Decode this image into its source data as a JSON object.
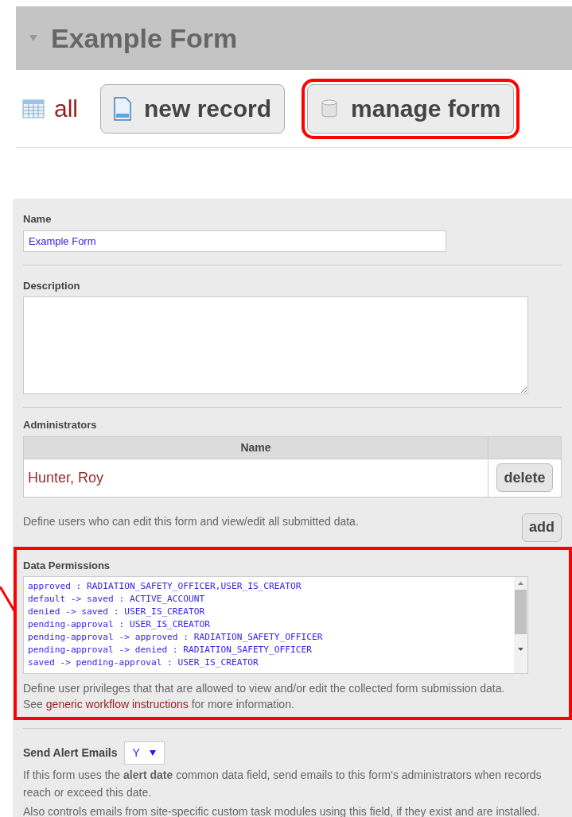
{
  "header": {
    "title": "Example Form",
    "expanded": true
  },
  "toolbar": {
    "all_link": "all",
    "buttons": [
      {
        "kind": "record",
        "label": "new record",
        "highlighted": false
      },
      {
        "kind": "database",
        "label": "manage form",
        "highlighted": true
      }
    ]
  },
  "form": {
    "name": {
      "label": "Name",
      "value": "Example Form"
    },
    "description": {
      "label": "Description"
    },
    "administrators": {
      "label": "Administrators",
      "columns": [
        "Name"
      ],
      "rows": [
        {
          "name": "Hunter, Roy",
          "action": "delete"
        }
      ],
      "help": "Define users who can edit this form and view/edit all submitted data.",
      "add_button": "add"
    },
    "data_permissions": {
      "label": "Data Permissions",
      "highlighted": true,
      "lines": [
        "approved : RADIATION_SAFETY_OFFICER,USER_IS_CREATOR",
        "default -> saved : ACTIVE_ACCOUNT",
        "denied -> saved : USER_IS_CREATOR",
        "pending-approval : USER_IS_CREATOR",
        "pending-approval -> approved : RADIATION_SAFETY_OFFICER",
        "pending-approval -> denied : RADIATION_SAFETY_OFFICER",
        "saved -> pending-approval : USER_IS_CREATOR"
      ],
      "help": "Define user privileges that that are allowed to view and/or edit the collected form submission data.",
      "see_prefix": "See",
      "see_link": "generic workflow instructions",
      "see_suffix": "for more information."
    },
    "send_alert_emails": {
      "label": "Send Alert Emails",
      "value": "Y",
      "help": [
        "If this form uses the **alert date** common data field, send emails to this form's administrators when records reach or exceed this date.",
        "Also controls emails from site-specific custom task modules using this field, if they exist and are installed."
      ]
    }
  }
}
